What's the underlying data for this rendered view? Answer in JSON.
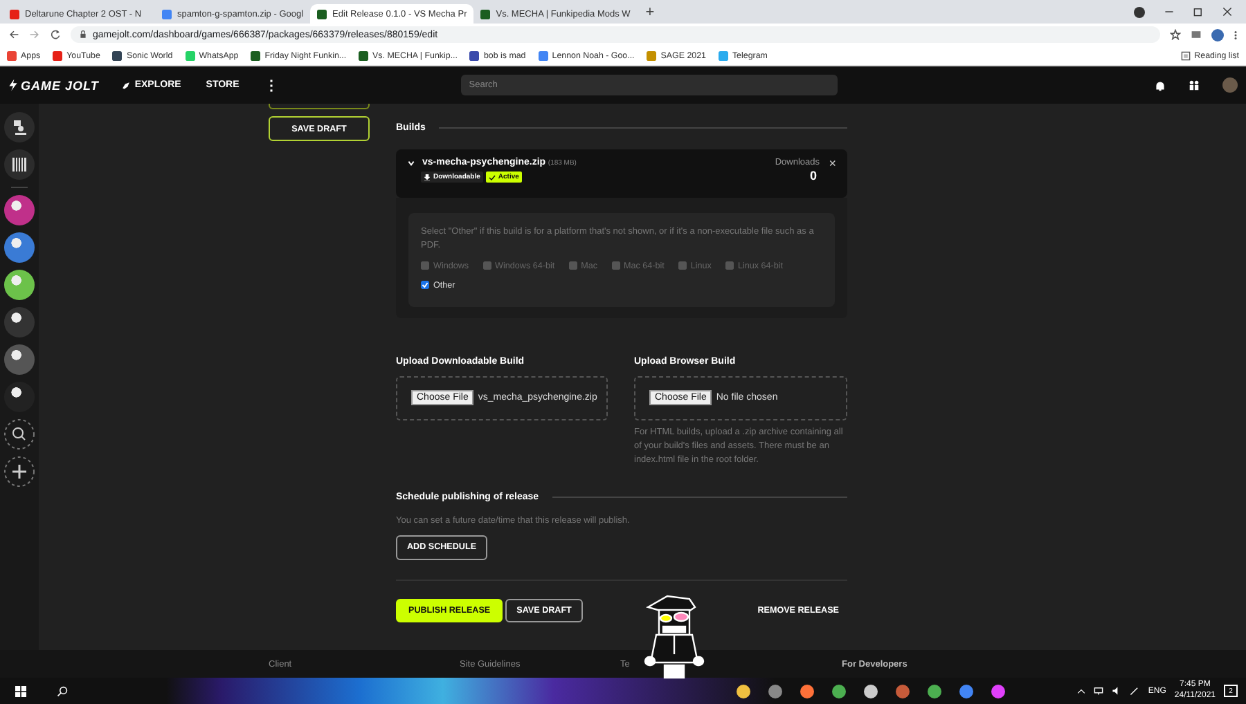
{
  "browser": {
    "tabs": [
      {
        "title": "Deltarune Chapter 2 OST - N",
        "selected": false
      },
      {
        "title": "spamton-g-spamton.zip - Googl",
        "selected": false
      },
      {
        "title": "Edit Release 0.1.0 - VS Mecha Pr",
        "selected": true
      },
      {
        "title": "Vs. MECHA | Funkipedia Mods W",
        "selected": false
      }
    ],
    "new_tab": "+",
    "url": "gamejolt.com/dashboard/games/666387/packages/663379/releases/880159/edit",
    "bookmarks": [
      "Apps",
      "YouTube",
      "Sonic World",
      "WhatsApp",
      "Friday Night Funkin...",
      "Vs. MECHA | Funkip...",
      "bob is mad",
      "Lennon Noah - Goo...",
      "SAGE 2021",
      "Telegram"
    ],
    "reading_list": "Reading list"
  },
  "header": {
    "logo": "GAME JOLT",
    "nav": [
      "EXPLORE",
      "STORE"
    ],
    "more": "⋮",
    "search": {
      "placeholder": "Search"
    }
  },
  "side_button": "SAVE DRAFT",
  "builds": {
    "title": "Builds",
    "build": {
      "filename": "vs-mecha-psychengine.zip",
      "size": "(183 MB)",
      "expanded": true,
      "badges": [
        {
          "label": "Downloadable",
          "kind": "download"
        },
        {
          "label": "Active",
          "kind": "active"
        }
      ],
      "downloads_label": "Downloads",
      "downloads": "0",
      "remove": "×"
    },
    "platform_hint": "Select \"Other\" if this build is for a platform that's not shown, or if it's a non-executable file such as a PDF.",
    "platforms": [
      {
        "label": "Windows",
        "checked": false
      },
      {
        "label": "Windows 64-bit",
        "checked": false
      },
      {
        "label": "Mac",
        "checked": false
      },
      {
        "label": "Mac 64-bit",
        "checked": false
      },
      {
        "label": "Linux",
        "checked": false
      },
      {
        "label": "Linux 64-bit",
        "checked": false
      },
      {
        "label": "Other",
        "checked": true
      }
    ]
  },
  "upload": [
    {
      "title": "Upload Downloadable Build",
      "button": "Choose File",
      "file": "vs_mecha_psychengine.zip"
    },
    {
      "title": "Upload Browser Build",
      "button": "Choose File",
      "file": "No file chosen",
      "hint": "For HTML builds, upload a .zip archive containing all of your build's files and assets. There must be an index.html file in the root folder."
    }
  ],
  "schedule": {
    "title": "Schedule publishing of release",
    "text": "You can set a future date/time that this release will publish.",
    "button": "ADD SCHEDULE"
  },
  "actions": [
    {
      "label": "PUBLISH RELEASE",
      "kind": "primary"
    },
    {
      "label": "SAVE DRAFT",
      "kind": "outline"
    },
    {
      "label": "REMOVE RELEASE",
      "kind": "text"
    }
  ],
  "footer": [
    "Client",
    "Site Guidelines",
    "Te",
    "For Developers"
  ],
  "taskbar": {
    "language": "ENG",
    "time": "7:45 PM",
    "date": "24/11/2021",
    "notifications": "2"
  }
}
